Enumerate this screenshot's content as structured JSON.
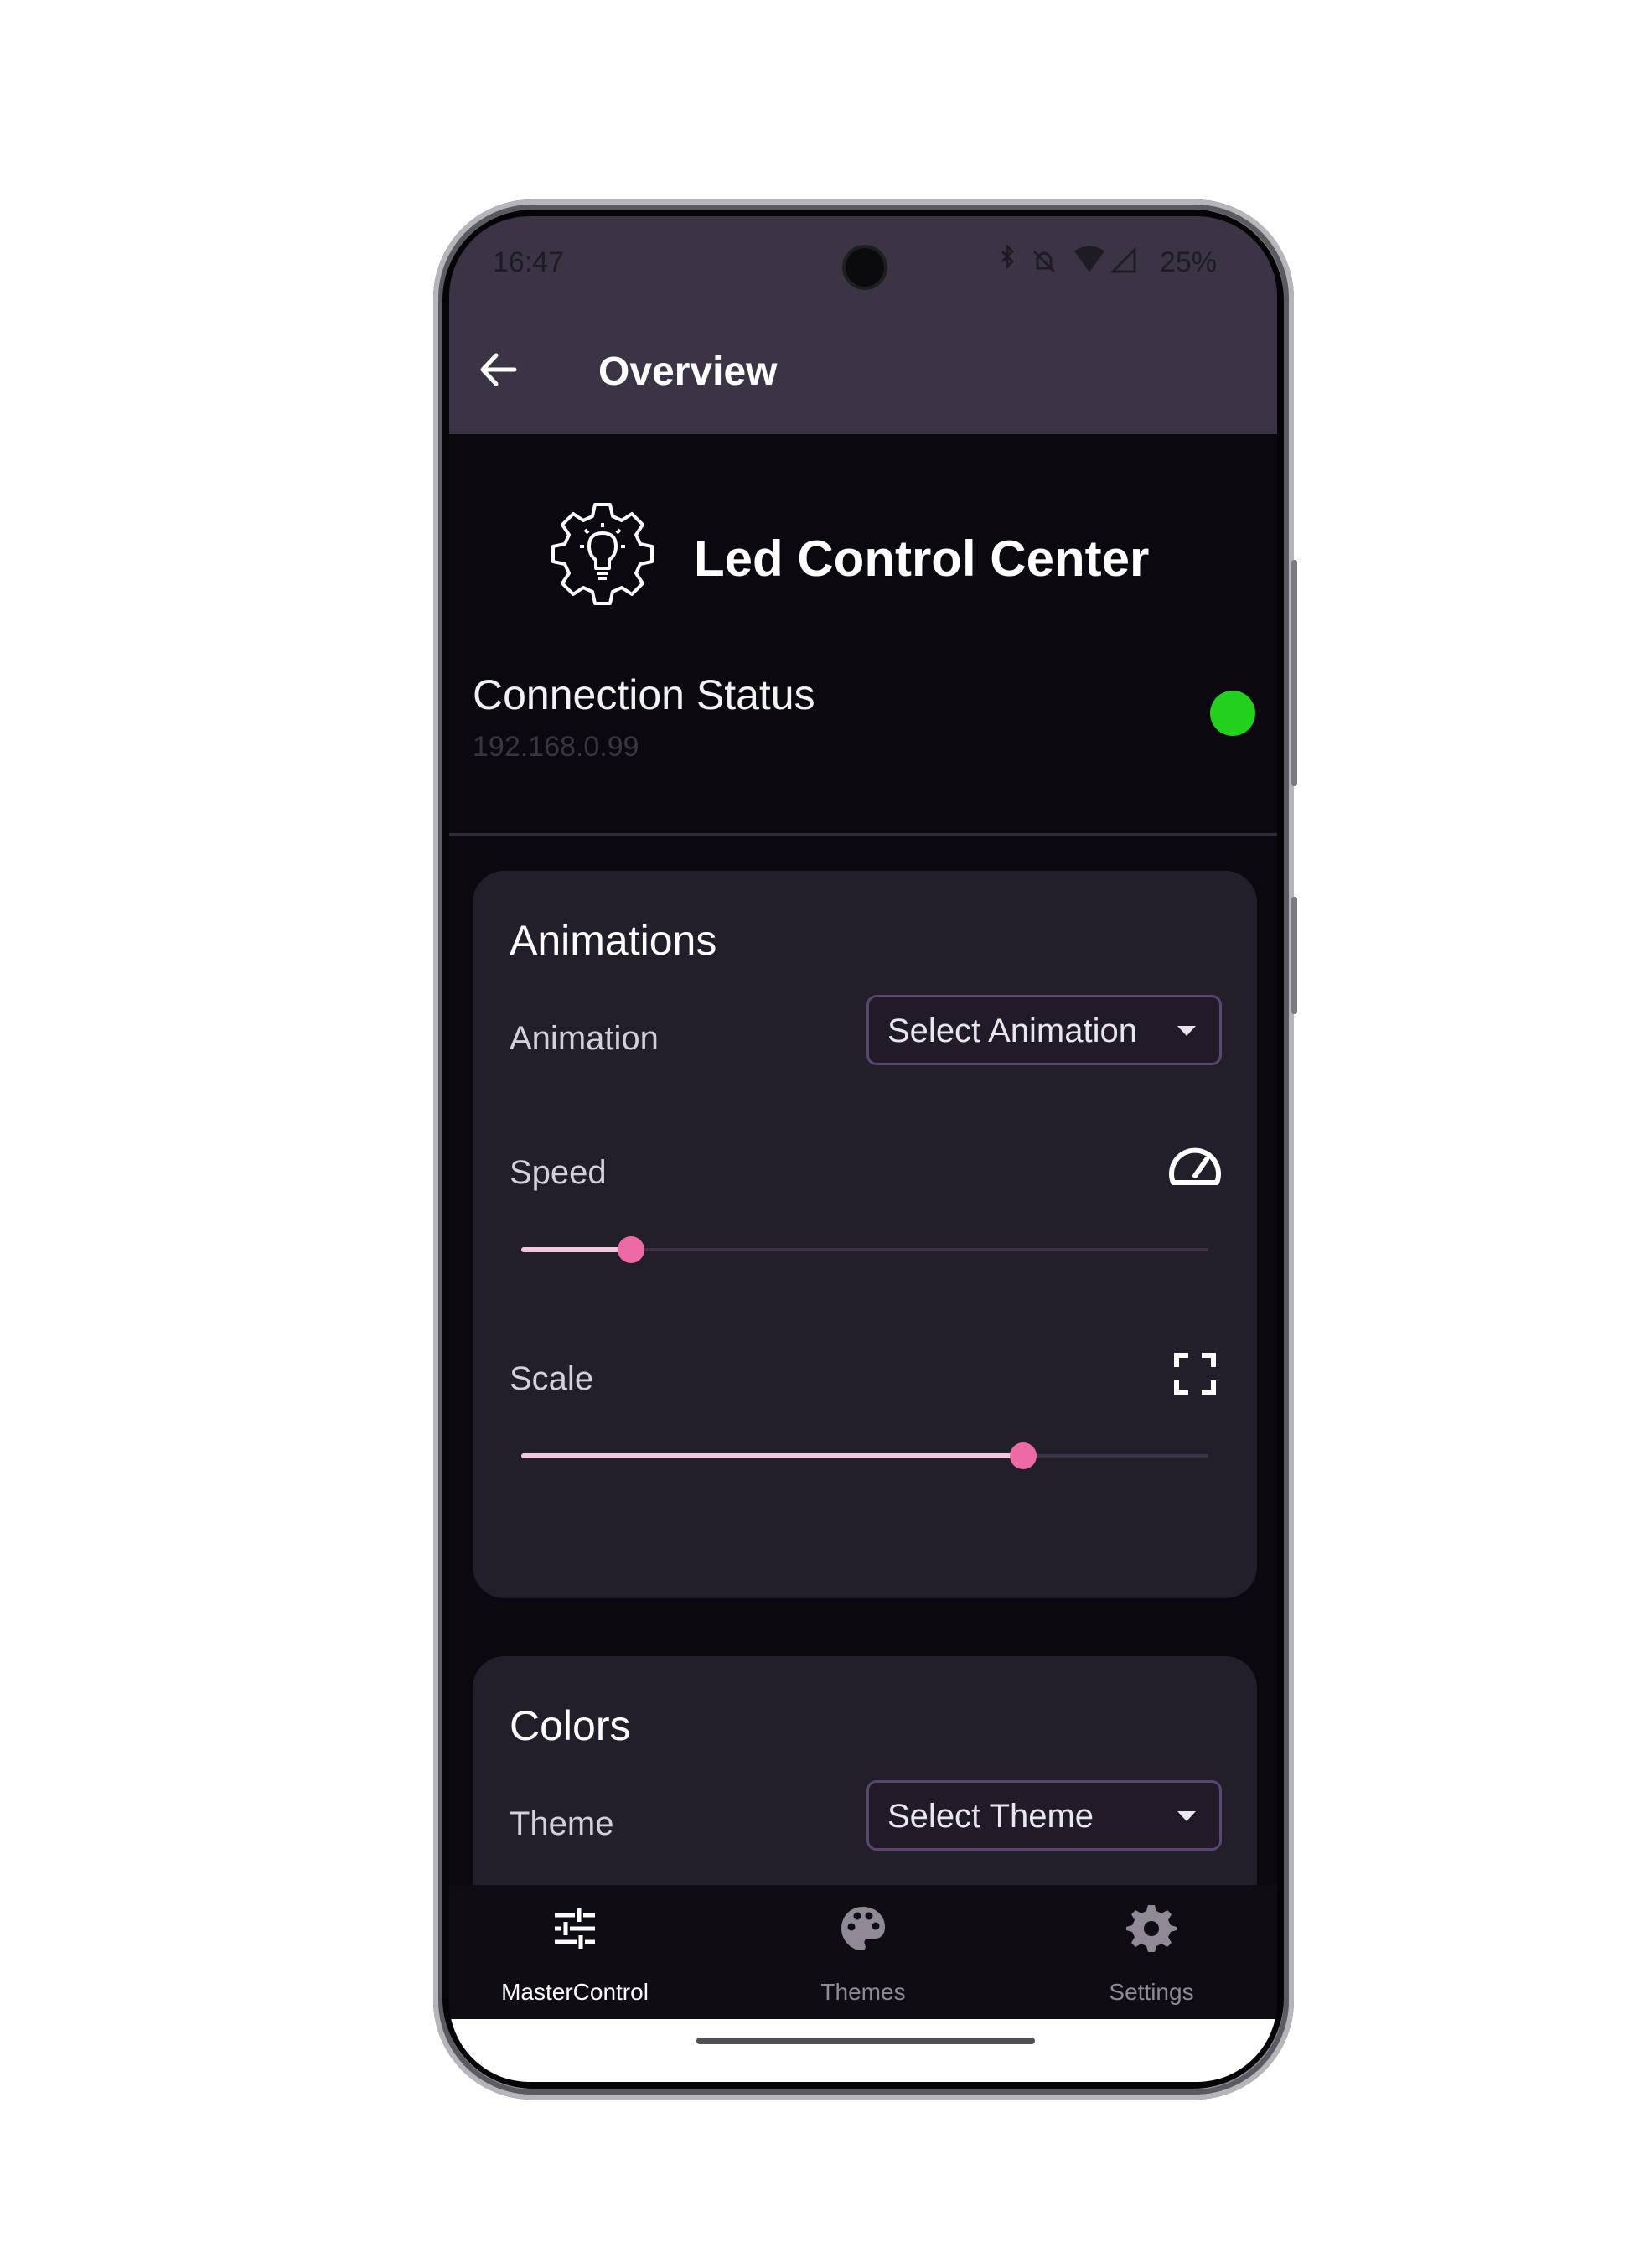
{
  "status_bar": {
    "time": "16:47",
    "battery": "25%"
  },
  "header": {
    "title": "Overview"
  },
  "app": {
    "name": "Led Control Center"
  },
  "connection": {
    "label": "Connection Status",
    "ip": "192.168.0.99",
    "status_color": "#22d11e"
  },
  "animations": {
    "title": "Animations",
    "animation_label": "Animation",
    "animation_dropdown": "Select Animation",
    "speed_label": "Speed",
    "speed_value": 0.16,
    "scale_label": "Scale",
    "scale_value": 0.73
  },
  "colors": {
    "title": "Colors",
    "theme_label": "Theme",
    "theme_dropdown": "Select Theme"
  },
  "nav": {
    "items": [
      {
        "label": "MasterControl",
        "icon": "sliders-icon",
        "active": true
      },
      {
        "label": "Themes",
        "icon": "palette-icon",
        "active": false
      },
      {
        "label": "Settings",
        "icon": "gear-icon",
        "active": false
      }
    ]
  },
  "theme_colors": {
    "accent": "#ee6aa7",
    "appbar": "#3b3444",
    "card": "#231f2a",
    "background": "#0b0810"
  }
}
